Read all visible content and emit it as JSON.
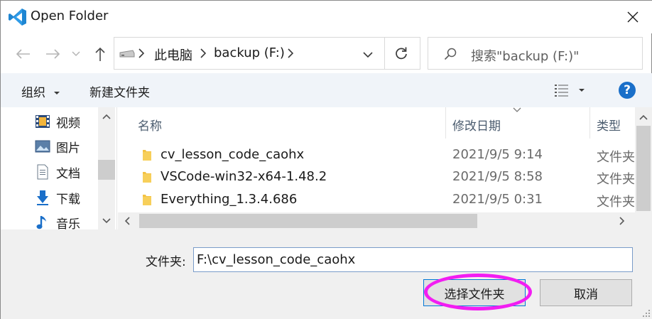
{
  "window": {
    "title": "Open Folder",
    "close_label": "✕"
  },
  "nav": {
    "back_label": "←",
    "forward_label": "→",
    "history_label": "⌄",
    "up_label": "↑"
  },
  "address": {
    "crumbs": [
      "此电脑",
      "backup (F:)"
    ],
    "search_placeholder": "搜索\"backup (F:)\""
  },
  "commands": {
    "organize": "组织",
    "new_folder": "新建文件夹",
    "help_label": "?"
  },
  "nav_pane": {
    "items": [
      {
        "label": "视频",
        "icon": "video-icon"
      },
      {
        "label": "图片",
        "icon": "pictures-icon"
      },
      {
        "label": "文档",
        "icon": "documents-icon"
      },
      {
        "label": "下载",
        "icon": "downloads-icon"
      },
      {
        "label": "音乐",
        "icon": "music-icon"
      }
    ]
  },
  "file_list": {
    "columns": [
      "名称",
      "修改日期",
      "类型"
    ],
    "rows": [
      {
        "name": "cv_lesson_code_caohx",
        "date": "2021/9/5 9:14",
        "type": "文件夹"
      },
      {
        "name": "VSCode-win32-x64-1.48.2",
        "date": "2021/9/5 8:58",
        "type": "文件夹"
      },
      {
        "name": "Everything_1.3.4.686",
        "date": "2021/9/5 0:31",
        "type": "文件夹"
      }
    ]
  },
  "bottom": {
    "folder_label": "文件夹:",
    "folder_value": "F:\\cv_lesson_code_caohx",
    "select_button": "选择文件夹",
    "cancel_button": "取消"
  },
  "colors": {
    "accent": "#0078d7",
    "highlight": "#f21df2",
    "folder": "#f3c244"
  }
}
